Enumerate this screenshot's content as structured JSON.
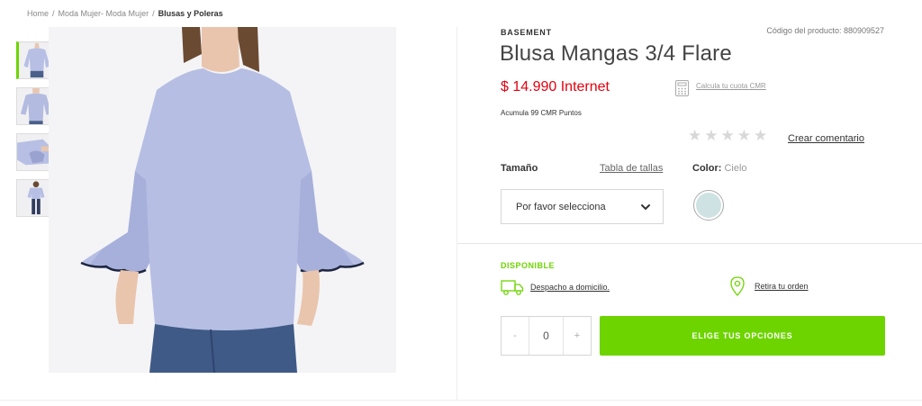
{
  "breadcrumb": {
    "home": "Home",
    "category": "Moda Mujer- Moda Mujer",
    "current": "Blusas y Poleras",
    "separator": "/"
  },
  "product": {
    "brand": "BASEMENT",
    "sku_text": "Código del producto: 880909527",
    "title": "Blusa Mangas 3/4 Flare",
    "price": "$ 14.990 Internet",
    "cmr_points": "Acumula 99 CMR Puntos",
    "installment_link": "Calcula tu cuota CMR",
    "rating_stars": 0,
    "rating_max": 5,
    "review_link": "Crear comentario"
  },
  "options": {
    "size_label": "Tamaño",
    "size_table_link": "Tabla de tallas",
    "size_select_value": "Por favor selecciona",
    "color_label": "Color:",
    "color_value": "Cielo",
    "swatch_color": "#cfe2e3"
  },
  "availability": {
    "status": "DISPONIBLE",
    "delivery_link": "Despacho a domicilio.",
    "pickup_link": "Retira tu orden"
  },
  "purchase": {
    "minus": "-",
    "quantity": "0",
    "plus": "+",
    "cta_label": "ELIGE TUS OPCIONES"
  },
  "colors": {
    "accent_green": "#6ed400",
    "price_red": "#e4000f"
  },
  "icons": {
    "calculator": "calculator-icon",
    "truck": "truck-icon",
    "pin": "location-pin-icon",
    "chevron": "chevron-down-icon",
    "star": "star-icon"
  }
}
